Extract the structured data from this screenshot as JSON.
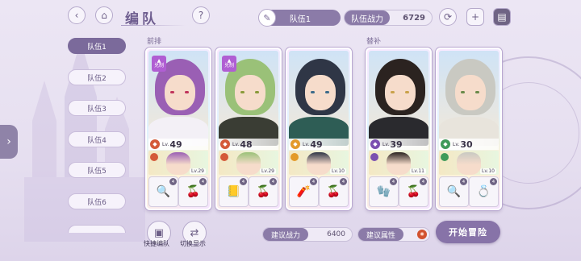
{
  "header": {
    "title": "编队",
    "team_name": "队伍1",
    "team_power_label": "队伍战力",
    "team_power_value": "6729"
  },
  "icons": {
    "back": "back-arrow-icon",
    "home": "castle-home-icon",
    "help": "question-icon",
    "team_name_edit": "feather-icon",
    "refresh": "refresh-icon",
    "add": "add-square-icon",
    "lock": "clipboard-icon"
  },
  "sidebar": {
    "tabs": [
      {
        "label": "队伍1",
        "active": true
      },
      {
        "label": "队伍2",
        "active": false
      },
      {
        "label": "队伍3",
        "active": false
      },
      {
        "label": "队伍4",
        "active": false
      },
      {
        "label": "队伍5",
        "active": false
      },
      {
        "label": "队伍6",
        "active": false
      }
    ]
  },
  "sections": {
    "front": "前排",
    "substitute": "替补"
  },
  "cards": [
    {
      "level": "49",
      "sub_level": "Lv.29",
      "badge": "兑制",
      "element_color": "#d45a3a",
      "hair": "#9a5fb4",
      "outfit": "#f3f0f6",
      "eye": "#c0345c",
      "item_badges": [
        "4",
        "4"
      ],
      "items": [
        "🔍",
        "🍒"
      ]
    },
    {
      "level": "48",
      "sub_level": "Lv.29",
      "badge": "兑制",
      "element_color": "#d45a3a",
      "hair": "#9ac178",
      "outfit": "#3a3d34",
      "eye": "#8a9a3a",
      "item_badges": [
        "4",
        "4"
      ],
      "items": [
        "📒",
        "🍒"
      ]
    },
    {
      "level": "49",
      "sub_level": "Lv.10",
      "badge": "",
      "element_color": "#e39a2a",
      "hair": "#2f3646",
      "outfit": "#2e5d55",
      "eye": "#3c6b8a",
      "item_badges": [
        "4",
        "4"
      ],
      "items": [
        "🧨",
        "🍒"
      ]
    },
    {
      "level": "39",
      "sub_level": "Lv.11",
      "badge": "",
      "element_color": "#7b4fb0",
      "hair": "#2b2320",
      "outfit": "#2a2a2e",
      "eye": "#c9a24a",
      "item_badges": [
        "4",
        "4"
      ],
      "items": [
        "🧤",
        "🍒"
      ]
    },
    {
      "level": "30",
      "sub_level": "Lv.10",
      "badge": "",
      "element_color": "#3f9a5a",
      "hair": "#c9c9c2",
      "outfit": "#e8e4dc",
      "eye": "#6a8a4a",
      "item_badges": [
        "4",
        "4"
      ],
      "items": [
        "🔍",
        "💍"
      ]
    }
  ],
  "lv_prefix": "Lv.",
  "footer": {
    "quick_team": "快捷编队",
    "switch_display": "切换显示",
    "suggested_power_label": "建议战力",
    "suggested_power_value": "6400",
    "suggested_attr_label": "建议属性",
    "start_button": "开始冒险"
  }
}
